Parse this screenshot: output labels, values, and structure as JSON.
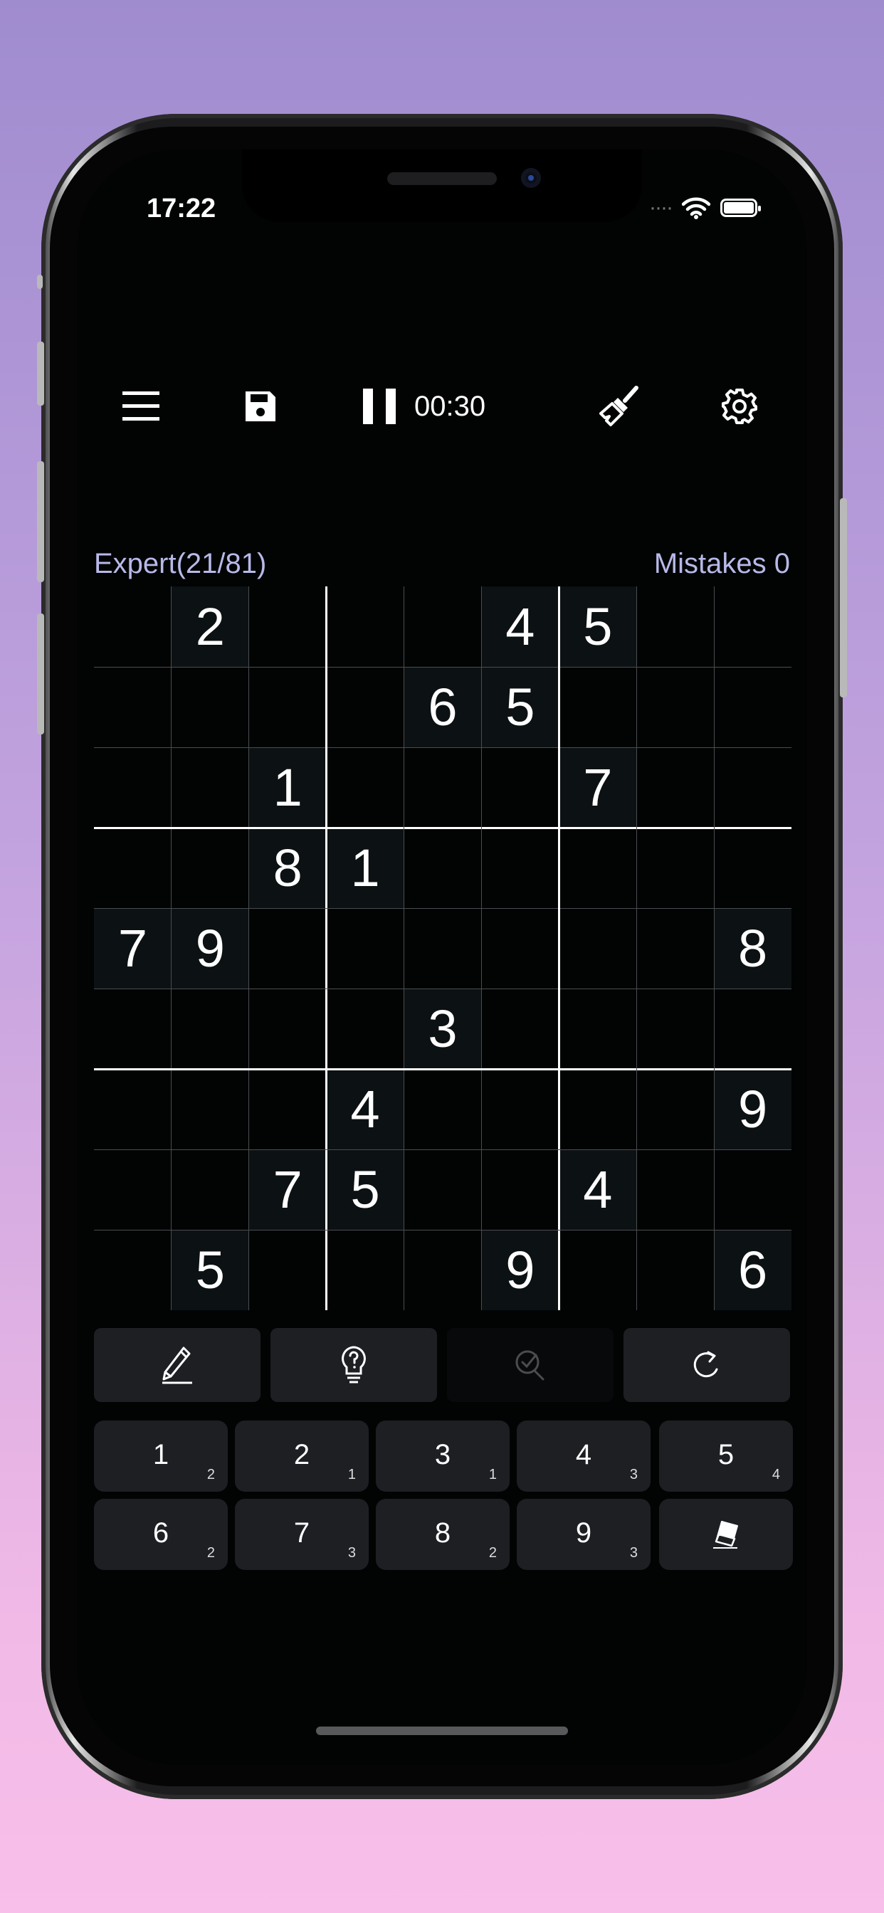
{
  "status_bar": {
    "time": "17:22"
  },
  "toolbar": {
    "timer": "00:30"
  },
  "info": {
    "difficulty": "Expert(21/81)",
    "mistakes": "Mistakes 0"
  },
  "board": {
    "rows": [
      [
        "",
        "2",
        "",
        "",
        "",
        "4",
        "5",
        "",
        ""
      ],
      [
        "",
        "",
        "",
        "",
        "6",
        "5",
        "",
        "",
        ""
      ],
      [
        "",
        "",
        "1",
        "",
        "",
        "",
        "7",
        "",
        ""
      ],
      [
        "",
        "",
        "8",
        "1",
        "",
        "",
        "",
        "",
        ""
      ],
      [
        "7",
        "9",
        "",
        "",
        "",
        "",
        "",
        "",
        "8"
      ],
      [
        "",
        "",
        "",
        "",
        "3",
        "",
        "",
        "",
        ""
      ],
      [
        "",
        "",
        "",
        "4",
        "",
        "",
        "",
        "",
        "9"
      ],
      [
        "",
        "",
        "7",
        "5",
        "",
        "",
        "4",
        "",
        ""
      ],
      [
        "",
        "5",
        "",
        "",
        "",
        "9",
        "",
        "",
        "6"
      ]
    ]
  },
  "actions": [
    {
      "icon": "pencil-icon",
      "enabled": true
    },
    {
      "icon": "lightbulb-hint-icon",
      "enabled": true
    },
    {
      "icon": "check-magnifier-icon",
      "enabled": false
    },
    {
      "icon": "undo-icon",
      "enabled": true
    }
  ],
  "numpad": [
    {
      "digit": "1",
      "remaining": "2"
    },
    {
      "digit": "2",
      "remaining": "1"
    },
    {
      "digit": "3",
      "remaining": "1"
    },
    {
      "digit": "4",
      "remaining": "3"
    },
    {
      "digit": "5",
      "remaining": "4"
    },
    {
      "digit": "6",
      "remaining": "2"
    },
    {
      "digit": "7",
      "remaining": "3"
    },
    {
      "digit": "8",
      "remaining": "2"
    },
    {
      "digit": "9",
      "remaining": "3"
    },
    {
      "icon": "eraser-icon"
    }
  ],
  "colors": {
    "background_top": "#9f8ccf",
    "background_bottom": "#f7bfe9",
    "accent_text": "#b8b9e8",
    "screen": "#020404"
  }
}
